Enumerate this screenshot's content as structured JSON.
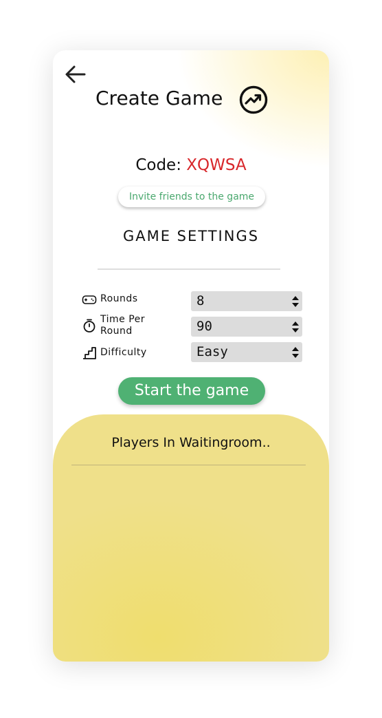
{
  "header": {
    "title": "Create Game",
    "back_icon": "arrow-left-icon",
    "title_icon": "trending-up-circle-icon"
  },
  "code": {
    "label": "Code:",
    "value": "XQWSA"
  },
  "invite_button": "Invite friends to the game",
  "settings": {
    "title": "GAME SETTINGS",
    "rows": [
      {
        "icon": "gamepad-icon",
        "label": "Rounds",
        "value": "8"
      },
      {
        "icon": "stopwatch-icon",
        "label_line1": "Time Per",
        "label_line2": "Round",
        "value": "90"
      },
      {
        "icon": "stairs-icon",
        "label": "Difficulty",
        "value": "Easy"
      }
    ]
  },
  "start_button": "Start the game",
  "waiting_room": {
    "title": "Players In Waitingroom.."
  },
  "colors": {
    "code_value": "#d8262a",
    "accent_green": "#4fb173",
    "panel_yellow": "#efe08a"
  }
}
